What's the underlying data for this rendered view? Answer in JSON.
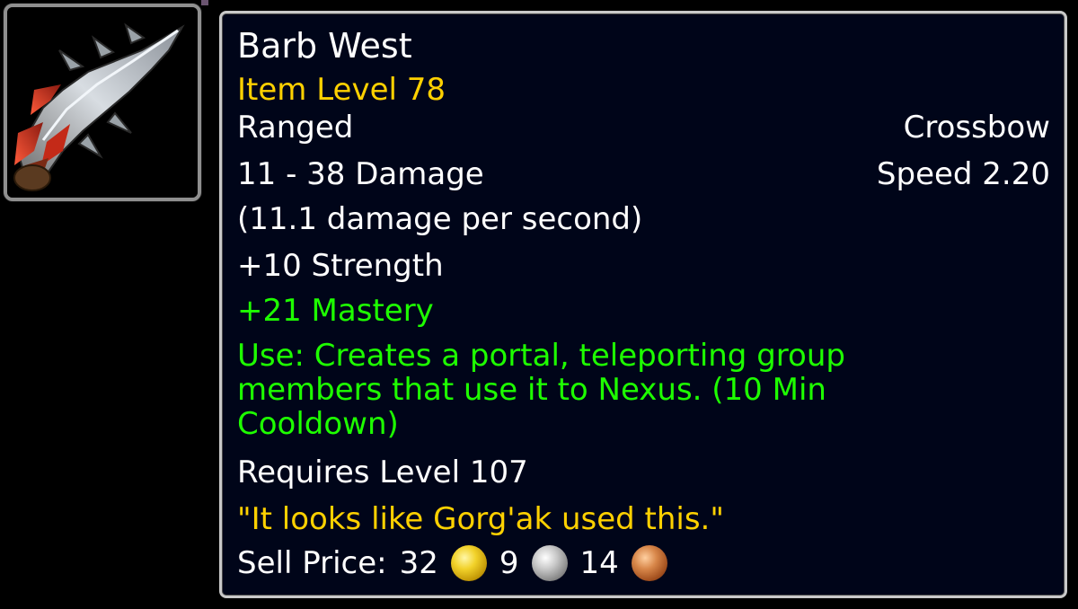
{
  "item": {
    "name": "Barb West",
    "item_level": "Item Level 78",
    "slot": "Ranged",
    "type": "Crossbow",
    "damage": "11 - 38 Damage",
    "speed": "Speed 2.20",
    "dps": "(11.1 damage per second)",
    "stat_strength": "+10 Strength",
    "stat_mastery": "+21 Mastery",
    "use_effect": "Use: Creates a portal, teleporting group members that use it to Nexus. (10 Min Cooldown)",
    "requires": "Requires Level 107",
    "flavor": "\"It looks like Gorg'ak used this.\"",
    "sell_label": "Sell Price:",
    "sell_gold": "32",
    "sell_silver": "9",
    "sell_copper": "14",
    "icon": "crossbow-bolt-icon"
  },
  "colors": {
    "white_text": "#ffffff",
    "item_level": "#ffd100",
    "green_text": "#1eff00",
    "flavor": "#ffd100",
    "background": "#000519",
    "border": "#c9c9c9"
  }
}
